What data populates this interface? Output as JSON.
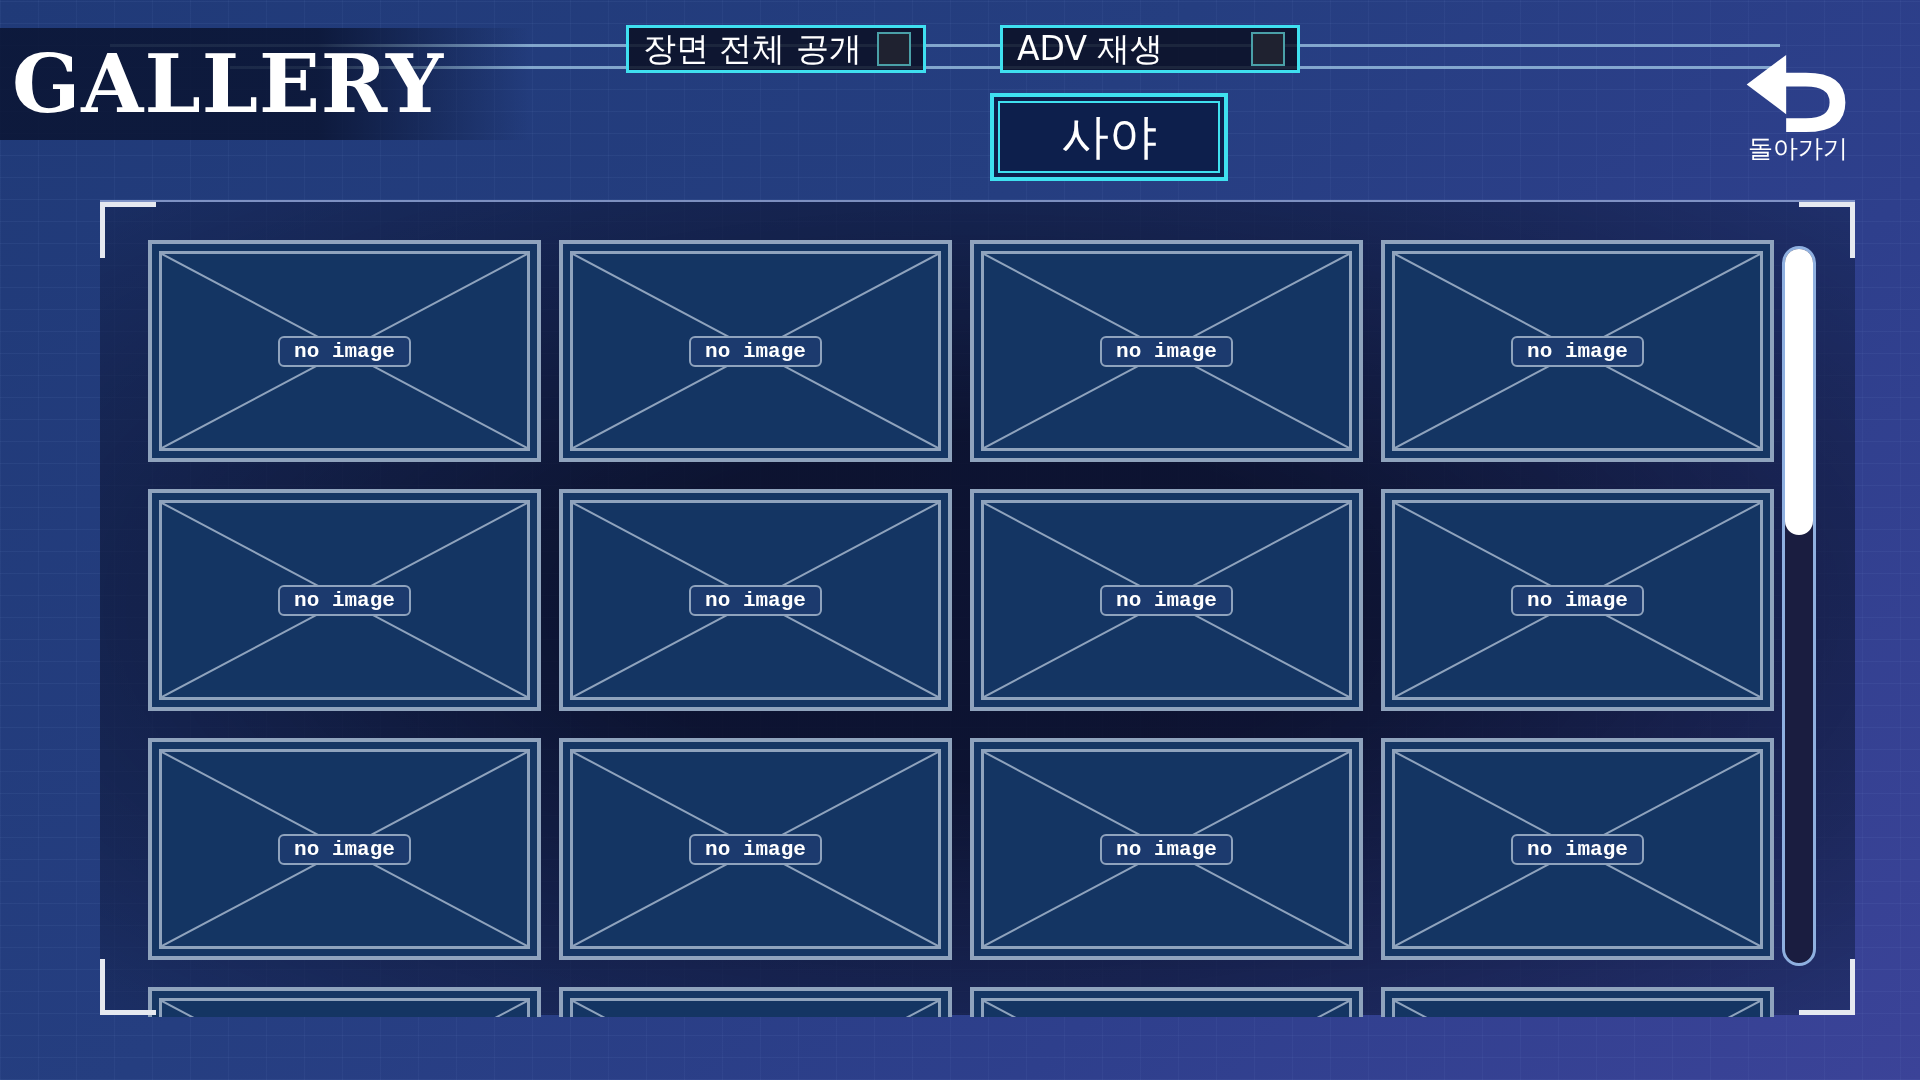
{
  "title": "GALLERY",
  "toggles": [
    {
      "label": "장면 전체 공개",
      "checked": false
    },
    {
      "label": "ADV 재생",
      "checked": false
    }
  ],
  "tabs": [
    {
      "label": "사야",
      "selected": true
    }
  ],
  "back": {
    "label": "돌아가기"
  },
  "tiles": [
    {
      "kind": "full",
      "label": "no image"
    },
    {
      "kind": "full",
      "label": "no image"
    },
    {
      "kind": "full",
      "label": "no image"
    },
    {
      "kind": "full",
      "label": "no image"
    },
    {
      "kind": "full",
      "label": "no image"
    },
    {
      "kind": "full",
      "label": "no image"
    },
    {
      "kind": "full",
      "label": "no image"
    },
    {
      "kind": "full",
      "label": "no image"
    },
    {
      "kind": "full",
      "label": "no image"
    },
    {
      "kind": "full",
      "label": "no image"
    },
    {
      "kind": "full",
      "label": "no image"
    },
    {
      "kind": "full",
      "label": "no image"
    },
    {
      "kind": "partial"
    },
    {
      "kind": "partial"
    },
    {
      "kind": "partial"
    },
    {
      "kind": "partial"
    }
  ]
}
